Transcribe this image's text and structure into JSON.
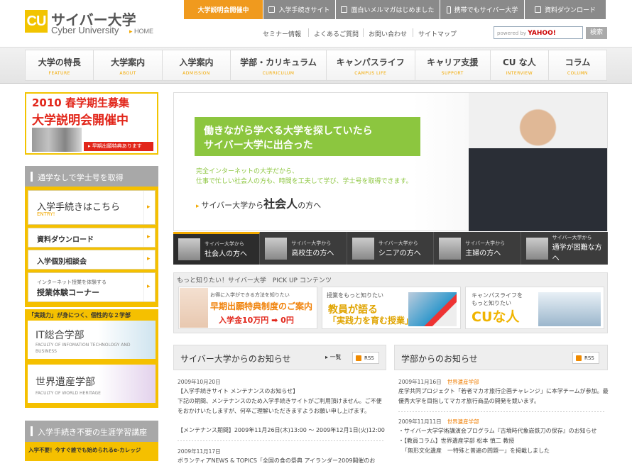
{
  "header": {
    "logo_mark": "CU",
    "logo_ja": "サイバー大学",
    "logo_en": "Cyber University",
    "home_label": "HOME",
    "top_tabs": [
      "大学説明会開催中",
      "入学手続きサイト",
      "面白いメルマガはじめました",
      "携帯でもサイバー大学",
      "資料ダウンロード"
    ],
    "sub_links": [
      "セミナー情報",
      "よくあるご質問",
      "お問い合わせ",
      "サイトマップ"
    ],
    "search_powered": "powered by",
    "search_brand": "YAHOO!",
    "search_button": "検索"
  },
  "nav": [
    {
      "ja": "大学の特長",
      "en": "FEATURE"
    },
    {
      "ja": "大学案内",
      "en": "ABOUT"
    },
    {
      "ja": "入学案内",
      "en": "ADMISSION"
    },
    {
      "ja": "学部・カリキュラム",
      "en": "CURRICULUM"
    },
    {
      "ja": "キャンパスライフ",
      "en": "CAMPUS LIFE"
    },
    {
      "ja": "キャリア支援",
      "en": "SUPPORT"
    },
    {
      "ja": "CU な人",
      "en": "INTERVIEW"
    },
    {
      "ja": "コラム",
      "en": "COLUMN"
    }
  ],
  "sidebar": {
    "promo_line1": "2010 春学期生募集",
    "promo_line2": "大学説明会開催中",
    "promo_tag": "▸ 早期出願特典あります",
    "section1_title": "通学なしで学士号を取得",
    "entry_ja": "入学手続きはこちら",
    "entry_en": "ENTRY!",
    "request_label": "資料ダウンロード",
    "consult_label": "入学個別相談会",
    "trial_small": "インターネット授業を体験する",
    "trial_label": "授業体験コーナー",
    "faculty_head": "「実践力」が身につく、個性的な２学部",
    "faculty_it": "IT総合学部",
    "faculty_it_en": "FACULTY OF INFOMATION TECHNOLOGY AND BUSINESS",
    "faculty_wh": "世界遺産学部",
    "faculty_wh_en": "FACULTY OF WORLD HERITAGE",
    "section2_title": "入学手続き不要の生涯学習講座",
    "section2_text": "入学不要！今すぐ誰でも始められるe-カレッジ"
  },
  "hero": {
    "headline1": "働きながら学べる大学を探していたら",
    "headline2": "サイバー大学に出合った",
    "text1": "完全インターネットの大学だから、",
    "text2": "仕事で忙しい社会人の方も、時間を工夫して学び、学士号を取得できます。",
    "link_pre": "サイバー大学から",
    "link_big": "社会人",
    "link_post": "の方へ"
  },
  "hero_tabs": [
    {
      "small": "サイバー大学から",
      "label": "社会人の方へ"
    },
    {
      "small": "サイバー大学から",
      "label": "高校生の方へ"
    },
    {
      "small": "サイバー大学から",
      "label": "シニアの方へ"
    },
    {
      "small": "サイバー大学から",
      "label": "主婦の方へ"
    },
    {
      "small": "サイバー大学から",
      "label": "通学が困難な方へ"
    }
  ],
  "pickup": {
    "title": "もっと知りたい！サイバー大学　PICK UP コンテンツ",
    "card1_small": "お得に入学ができる方法を知りたい",
    "card1_title": "早期出願特典制度のご案内",
    "card1_sub": "入学金10万円 ➡ 0円",
    "card2_small": "授業をもっと知りたい",
    "card2_title": "教員が語る",
    "card2_sub": "「実践力を育む授業」",
    "card3_small1": "キャンパスライフを",
    "card3_small2": "もっと知りたい",
    "card3_title": "CUな人"
  },
  "news": {
    "title": "サイバー大学からのお知らせ",
    "more": "一覧",
    "rss": "RSS",
    "items": [
      {
        "date": "2009年10月20日",
        "lines": [
          "【入学手続きサイト メンテナンスのお知らせ】",
          "下記の期間、メンテナンスのため入学手続きサイトがご利用頂けません。ご不便",
          "をおかけいたしますが、何卒ご理解いただきますようお願い申し上げます。",
          "",
          "【メンテナンス期間】2009年11月26日(木)13:00 〜 2009年12月1日(火)12:00"
        ]
      },
      {
        "date": "2009年11月17日",
        "lines": [
          "ボランティアNEWS & TOPICS「全国の食の祭典 アイランダー2009開催のお"
        ]
      }
    ]
  },
  "faculty_news": {
    "title": "学部からのお知らせ",
    "rss": "RSS",
    "items": [
      {
        "date": "2009年11月16日",
        "tag": "世界遺産学部",
        "lines": [
          "産学共同プロジェクト「若者マカオ旅行企画チャレンジ」に本学チームが参加。最",
          "優秀大学を目指してマカオ旅行商品の開発を競います。"
        ]
      },
      {
        "date": "2009年11月11日",
        "tag": "世界遺産学部",
        "lines": [
          "・サイバー大学学術講演会プログラム『古墳時代象嵌鉄刀の保存』のお知らせ",
          "・【教員コラム】世界遺産学部 松本 慎二 教授",
          "「無形文化遺産　一特殊と普遍の問題一」を掲載しました"
        ]
      }
    ]
  },
  "colors": {
    "accent": "#f2a900",
    "brand_yellow": "#f5c000",
    "green": "#8cc63f",
    "red": "#e2261a"
  }
}
